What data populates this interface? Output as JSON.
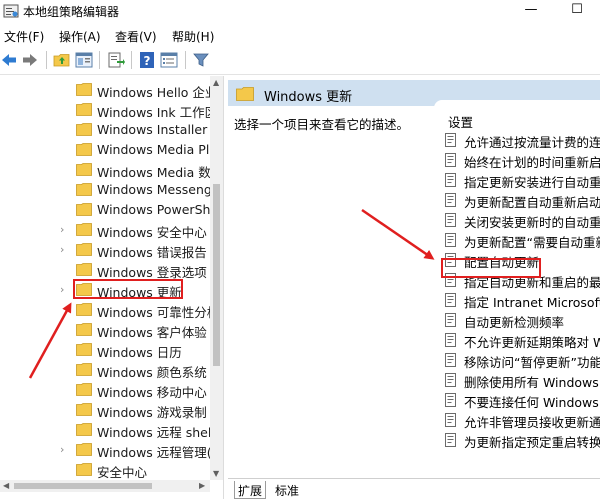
{
  "window": {
    "title": "本地组策略编辑器",
    "minimize_glyph": "—",
    "maximize_glyph": "☐"
  },
  "menu": [
    {
      "label": "文件(F)"
    },
    {
      "label": "操作(A)"
    },
    {
      "label": "查看(V)"
    },
    {
      "label": "帮助(H)"
    }
  ],
  "toolbar": {
    "icons": [
      "back-arrow-icon",
      "forward-arrow-icon",
      "up-folder-icon",
      "show-hide-tree-icon",
      "export-list-icon",
      "help-icon",
      "properties-icon",
      "filter-icon"
    ]
  },
  "tree": {
    "items": [
      {
        "label": "Windows Hello 企业",
        "expandable": false
      },
      {
        "label": "Windows Ink 工作区",
        "expandable": false
      },
      {
        "label": "Windows Installer",
        "expandable": false
      },
      {
        "label": "Windows Media Pl",
        "expandable": false
      },
      {
        "label": "Windows Media 数",
        "expandable": false
      },
      {
        "label": "Windows Messeng",
        "expandable": false
      },
      {
        "label": "Windows PowerSh",
        "expandable": false
      },
      {
        "label": "Windows 安全中心",
        "expandable": true
      },
      {
        "label": "Windows 错误报告",
        "expandable": true
      },
      {
        "label": "Windows 登录选项",
        "expandable": false
      },
      {
        "label": "Windows 更新",
        "expandable": true,
        "selected": true
      },
      {
        "label": "Windows 可靠性分析",
        "expandable": false
      },
      {
        "label": "Windows 客户体验",
        "expandable": false
      },
      {
        "label": "Windows 日历",
        "expandable": false
      },
      {
        "label": "Windows 颜色系统",
        "expandable": false
      },
      {
        "label": "Windows 移动中心",
        "expandable": false
      },
      {
        "label": "Windows 游戏录制",
        "expandable": false
      },
      {
        "label": "Windows 远程 shel",
        "expandable": false
      },
      {
        "label": "Windows 远程管理(",
        "expandable": true
      },
      {
        "label": "安全中心",
        "expandable": false
      }
    ]
  },
  "details": {
    "header_title": "Windows 更新",
    "description": "选择一个项目来查看它的描述。",
    "settings_header": "设置",
    "settings": [
      {
        "label": "允许通过按流量计费的连接"
      },
      {
        "label": "始终在计划的时间重新启动"
      },
      {
        "label": "指定更新安装进行自动重新"
      },
      {
        "label": "为更新配置自动重新启动提醒"
      },
      {
        "label": "关闭安装更新时的自动重新启"
      },
      {
        "label": "为更新配置“需要自动重新启"
      },
      {
        "label": "配置自动更新",
        "selected": true
      },
      {
        "label": "指定自动更新和重启的最后期"
      },
      {
        "label": "指定 Intranet Microsoft"
      },
      {
        "label": "自动更新检测频率"
      },
      {
        "label": "不允许更新延期策略对 W"
      },
      {
        "label": "移除访问“暂停更新”功能"
      },
      {
        "label": "删除使用所有 Windows 更"
      },
      {
        "label": "不要连接任何 Windows 更"
      },
      {
        "label": "允许非管理员接收更新通知"
      },
      {
        "label": "为更新指定预定重启转换"
      }
    ]
  },
  "tabs": [
    {
      "label": "扩展"
    },
    {
      "label": "标准"
    }
  ],
  "colors": {
    "folder": "#f4c84a",
    "header_strip": "#cfe0f0",
    "highlight_border": "#e01f1f",
    "annotation_arrow": "#e01f1f"
  }
}
